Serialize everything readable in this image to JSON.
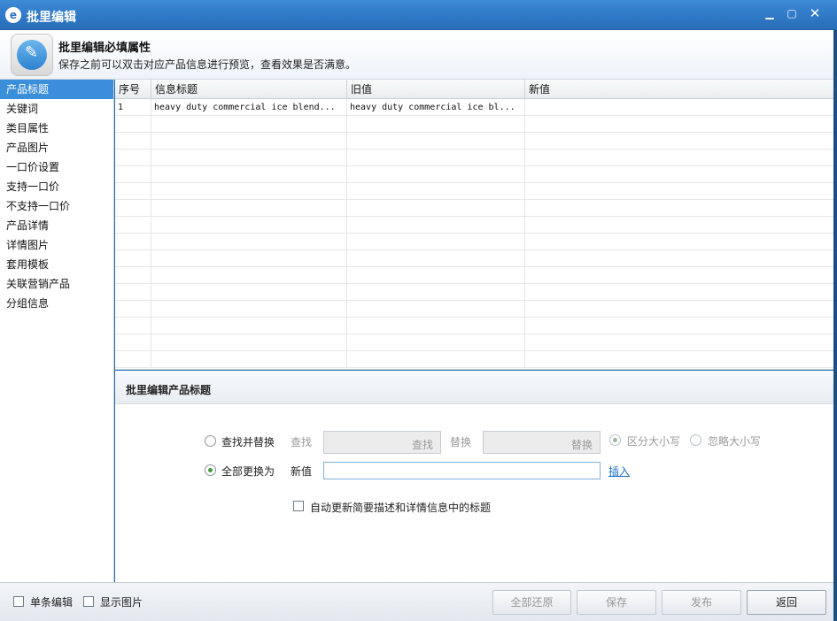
{
  "window": {
    "title": "批里编辑",
    "minimize": "▁",
    "maximize": "▢",
    "close": "✕"
  },
  "header": {
    "title": "批里编辑必填属性",
    "subtitle": "保存之前可以双击对应产品信息进行预览，查看效果是否满意。"
  },
  "sidebar": {
    "items": [
      {
        "label": "产品标题",
        "active": true
      },
      {
        "label": "关键词"
      },
      {
        "label": "类目属性"
      },
      {
        "label": "产品图片"
      },
      {
        "label": "一口价设置"
      },
      {
        "label": "支持一口价"
      },
      {
        "label": "不支持一口价"
      },
      {
        "label": "产品详情"
      },
      {
        "label": "详情图片"
      },
      {
        "label": "套用模板"
      },
      {
        "label": "关联营销产品"
      },
      {
        "label": "分组信息"
      }
    ]
  },
  "table": {
    "columns": [
      "序号",
      "信息标题",
      "旧值",
      "新值"
    ],
    "rows": [
      [
        "1",
        "heavy duty commercial ice blend...",
        "heavy duty commercial ice bl...",
        ""
      ]
    ]
  },
  "panel": {
    "title": "批里编辑产品标题",
    "find_replace_label": "查找并替换",
    "find_label": "查找",
    "find_placeholder": "查找",
    "replace_label": "替换",
    "replace_placeholder": "替换",
    "case_sensitive_label": "区分大小写",
    "ignore_case_label": "忽略大小写",
    "replace_all_label": "全部更换为",
    "new_value_label": "新值",
    "new_value": "",
    "insert_link": "插入",
    "auto_update_label": "自动更新简要描述和详情信息中的标题"
  },
  "footer": {
    "single_edit_label": "单条编辑",
    "show_images_label": "显示图片",
    "restore_all": "全部还原",
    "save": "保存",
    "publish": "发布",
    "back": "返回"
  }
}
